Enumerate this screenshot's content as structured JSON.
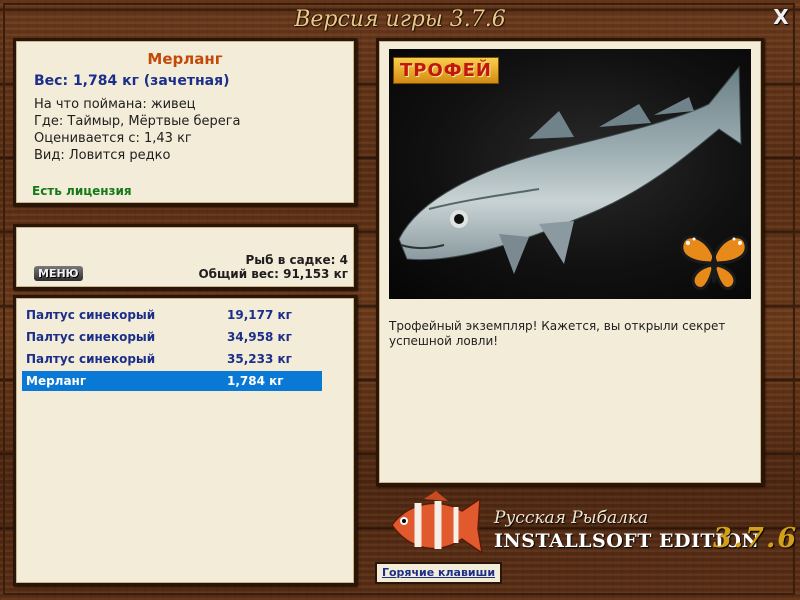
{
  "window": {
    "title": "Версия игры 3.7.6",
    "close_label": "X"
  },
  "fish_info": {
    "name": "Мерланг",
    "weight": "Вес: 1,784 кг (зачетная)",
    "details": [
      "На что поймана: живец",
      "Где: Таймыр, Мёртвые берега",
      "Оценивается с: 1,43 кг",
      "Вид: Ловится редко"
    ],
    "license": "Есть лицензия"
  },
  "catch_summary": {
    "menu_label": "МЕНЮ",
    "fish_count": "Рыб в садке: 4",
    "total_weight": "Общий вес: 91,153 кг"
  },
  "catch_list": {
    "selected_index": 3,
    "items": [
      {
        "name": "Палтус синекорый",
        "weight": "19,177 кг"
      },
      {
        "name": "Палтус синекорый",
        "weight": "34,958 кг"
      },
      {
        "name": "Палтус синекорый",
        "weight": "35,233 кг"
      },
      {
        "name": "Мерланг",
        "weight": "1,784 кг"
      }
    ]
  },
  "picture": {
    "trophy_badge": "ТРОФЕЙ",
    "description": "Трофейный экземпляр! Кажется, вы открыли секрет успешной ловли!"
  },
  "logo": {
    "line1": "Русская Рыбалка",
    "line2": "INSTALLSOFT EDITION",
    "version": "3.7.6"
  },
  "hotkeys_label": "Горячие клавиши",
  "colors": {
    "fish_name": "#c14a08",
    "weight_text": "#1b2f8a",
    "license_text": "#137a17",
    "selection": "#0a79d6",
    "panel_bg": "#f3ecd8",
    "version_gold": "#d4a017"
  }
}
